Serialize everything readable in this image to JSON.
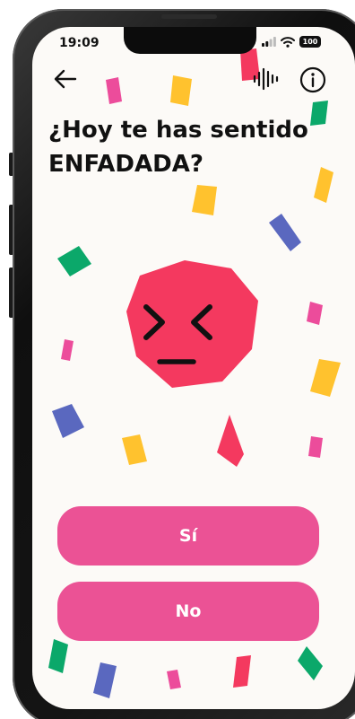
{
  "status_bar": {
    "time": "19:09",
    "battery": "100",
    "icons": [
      "signal-icon",
      "wifi-icon",
      "battery-icon"
    ]
  },
  "nav": {
    "icons": [
      "back-arrow-icon",
      "audio-waveform-icon",
      "info-icon"
    ]
  },
  "question": {
    "line1": "¿Hoy te has sentido",
    "line2": "ENFADADA?"
  },
  "emotion": {
    "icon": "angry-face-icon",
    "color": "#f4395f"
  },
  "answers": {
    "yes_label": "Sí",
    "no_label": "No",
    "button_color": "#eb5295"
  },
  "confetti_colors": [
    "#f4395f",
    "#ec4c9b",
    "#ffc22e",
    "#0ba86a",
    "#5a68bf"
  ]
}
